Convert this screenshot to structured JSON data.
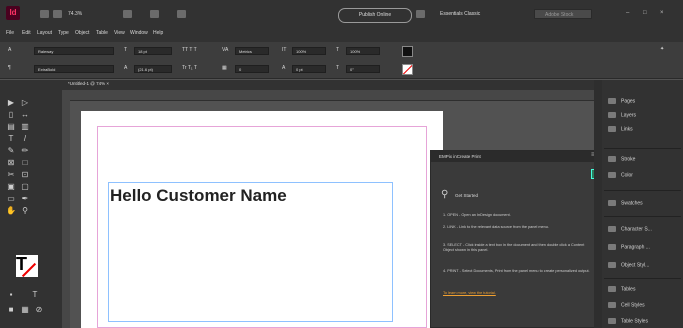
{
  "app": {
    "logo_text": "Id",
    "zoom": "74.3%",
    "publish_button": "Publish Online",
    "workspace": "Essentials Classic",
    "search_placeholder": "Adobe Stock",
    "window_controls": [
      "–",
      "□",
      "×"
    ]
  },
  "menu": [
    "File",
    "Edit",
    "Layout",
    "Type",
    "Object",
    "Table",
    "View",
    "Window",
    "Help"
  ],
  "control": {
    "font_family": "Raleway",
    "font_style": "ExtraBold",
    "font_size": "18 pt",
    "leading": "(21.6 pt)",
    "tracking": "Metrics",
    "scale_v": "100%",
    "scale_h": "100%",
    "baseline": "0 pt",
    "skew": "0°"
  },
  "document_tab": "*Untitled-1 @ 74% ×",
  "canvas": {
    "text": "Hello Customer Name"
  },
  "panel": {
    "title": "EMPix inCreate Print",
    "get_started": "Get Started",
    "steps": [
      "1. OPEN - Open an InDesign document.",
      "2. LINK - Link to the relevant data source from the panel menu.",
      "3. SELECT - Click inside a text box in the document and then double click a Content Object shown in this panel.",
      "4. PRINT - Select Documents, Print from the panel menu to create personalized output."
    ],
    "link_text": "To learn more, view the tutorial."
  },
  "right_panels": {
    "group1": [
      "Pages",
      "Layers",
      "Links"
    ],
    "group2": [
      "Stroke",
      "Color"
    ],
    "group3": [
      "Swatches"
    ],
    "group4": [
      "Character S...",
      "Paragraph ...",
      "Object Styl..."
    ],
    "group5": [
      "Tables",
      "Cell Styles",
      "Table Styles"
    ]
  },
  "colors": {
    "accent": "#ff3366",
    "frame": "#8ec1ff",
    "margin": "#e6a4d8",
    "panel_link": "#f0a030"
  }
}
